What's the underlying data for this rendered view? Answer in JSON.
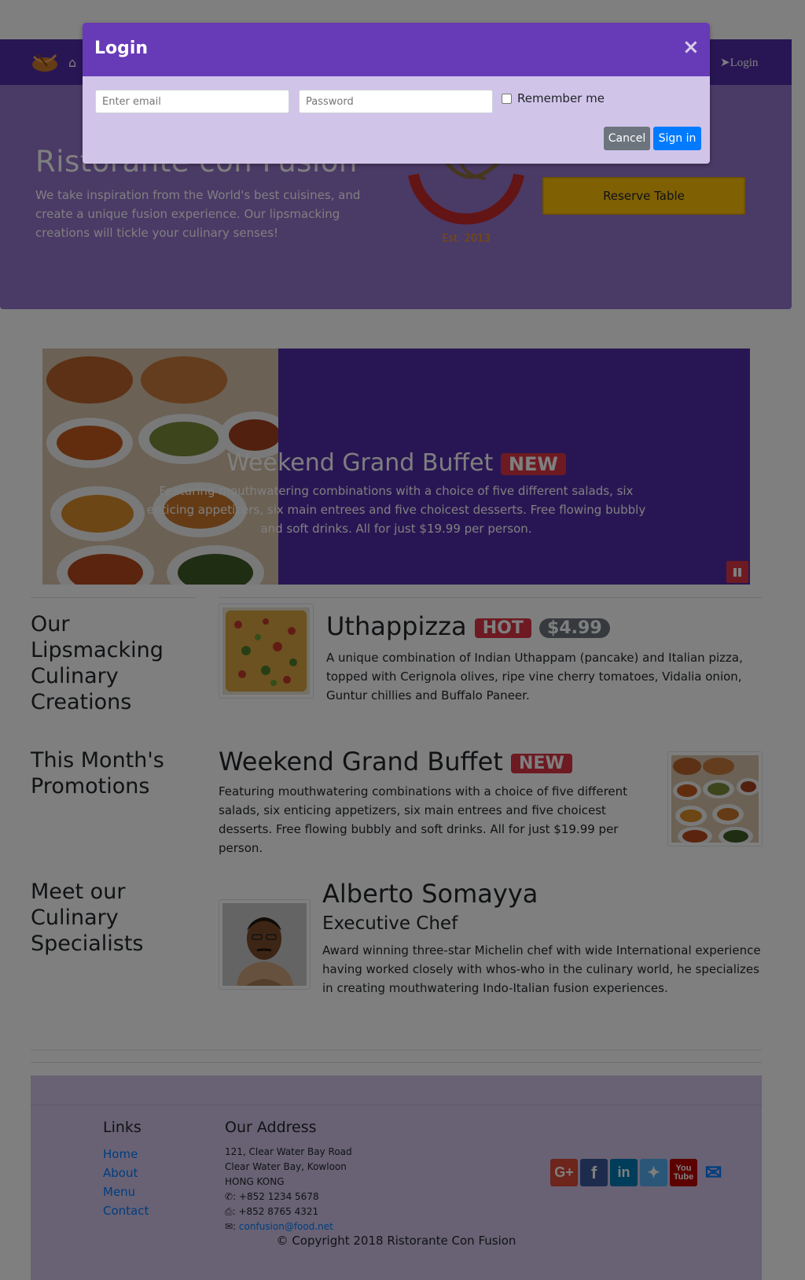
{
  "navbar": {
    "login_label": "Login"
  },
  "jumbotron": {
    "title": "Ristorante con Fusion",
    "description": "We take inspiration from the World's best cuisines, and create a unique fusion experience. Our lipsmacking creations will tickle your culinary senses!",
    "logo_text": "Ristorante con Fusion",
    "logo_est": "Est. 2013",
    "reserve_label": "Reserve Table"
  },
  "carousel": {
    "title": "Weekend Grand Buffet",
    "badge": "NEW",
    "text": "Featuring mouthwatering combinations with a choice of five different salads, six enticing appetizers, six main entrees and five choicest desserts. Free flowing bubbly and soft drinks. All for just $19.99 per person."
  },
  "creations": {
    "heading": "Our Lipsmacking Culinary Creations",
    "dish_title": "Uthappizza",
    "badge_hot": "HOT",
    "badge_price": "$4.99",
    "text": "A unique combination of Indian Uthappam (pancake) and Italian pizza, topped with Cerignola olives, ripe vine cherry tomatoes, Vidalia onion, Guntur chillies and Buffalo Paneer."
  },
  "promotions": {
    "heading": "This Month's Promotions",
    "title": "Weekend Grand Buffet",
    "badge": "NEW",
    "text": "Featuring mouthwatering combinations with a choice of five different salads, six enticing appetizers, six main entrees and five choicest desserts. Free flowing bubbly and soft drinks. All for just $19.99 per person."
  },
  "specialists": {
    "heading": "Meet our Culinary Specialists",
    "name": "Alberto Somayya",
    "role": "Executive Chef",
    "text": "Award winning three-star Michelin chef with wide International experience having worked closely with whos-who in the culinary world, he specializes in creating mouthwatering Indo-Italian fusion experiences."
  },
  "footer": {
    "links_heading": "Links",
    "links": [
      "Home",
      "About",
      "Menu",
      "Contact"
    ],
    "address_heading": "Our Address",
    "address_lines": [
      "121, Clear Water Bay Road",
      "Clear Water Bay, Kowloon",
      "HONG KONG"
    ],
    "phone": ": +852 1234 5678",
    "fax": ": +852 8765 4321",
    "email": "confusion@food.net",
    "copyright": "© Copyright 2018 Ristorante Con Fusion",
    "social_colors": {
      "google": "#dd4b39",
      "facebook": "#3b5998",
      "linkedin": "#007bb6",
      "twitter": "#55acee",
      "youtube": "#bb0000",
      "mail": "#007bff"
    }
  },
  "modal": {
    "title": "Login",
    "close": "×",
    "email_placeholder": "Enter email",
    "password_placeholder": "Password",
    "remember_label": "Remember me",
    "cancel_label": "Cancel",
    "signin_label": "Sign in"
  }
}
